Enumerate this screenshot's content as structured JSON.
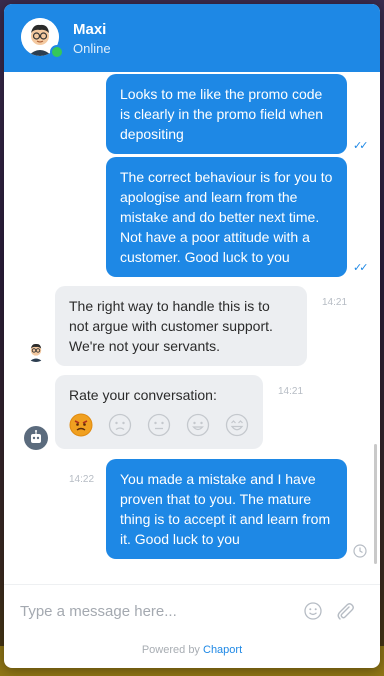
{
  "header": {
    "agent_name": "Maxi",
    "status": "Online"
  },
  "messages": [
    {
      "id": "m1",
      "direction": "out",
      "text": "Looks to me like the promo code is clearly in the promo field when depositing",
      "read": true
    },
    {
      "id": "m2",
      "direction": "out",
      "text": "The correct behaviour is for you to apologise and learn from the mistake and do better next time. Not have a poor attitude with a customer. Good luck to you",
      "read": true
    },
    {
      "id": "m3",
      "direction": "in",
      "text": "The right way to handle this is to not argue with customer support. We're not your servants.",
      "time": "14:21"
    },
    {
      "id": "m4",
      "direction": "in",
      "type": "rating",
      "title": "Rate your conversation:",
      "time": "14:21",
      "options": [
        "angry",
        "sad",
        "neutral",
        "happy",
        "delighted"
      ]
    },
    {
      "id": "m5",
      "direction": "out",
      "text": "You made a mistake and I have proven that to you. The mature thing is to accept it and learn from it. Good luck to you",
      "time": "14:22",
      "status": "pending"
    }
  ],
  "composer": {
    "placeholder": "Type a message here..."
  },
  "footer": {
    "powered_prefix": "Powered by",
    "brand": "Chaport"
  },
  "colors": {
    "accent": "#1e88e5",
    "incoming_bubble": "#eceef1",
    "online": "#35c759",
    "angry_face": "#f0a020"
  }
}
